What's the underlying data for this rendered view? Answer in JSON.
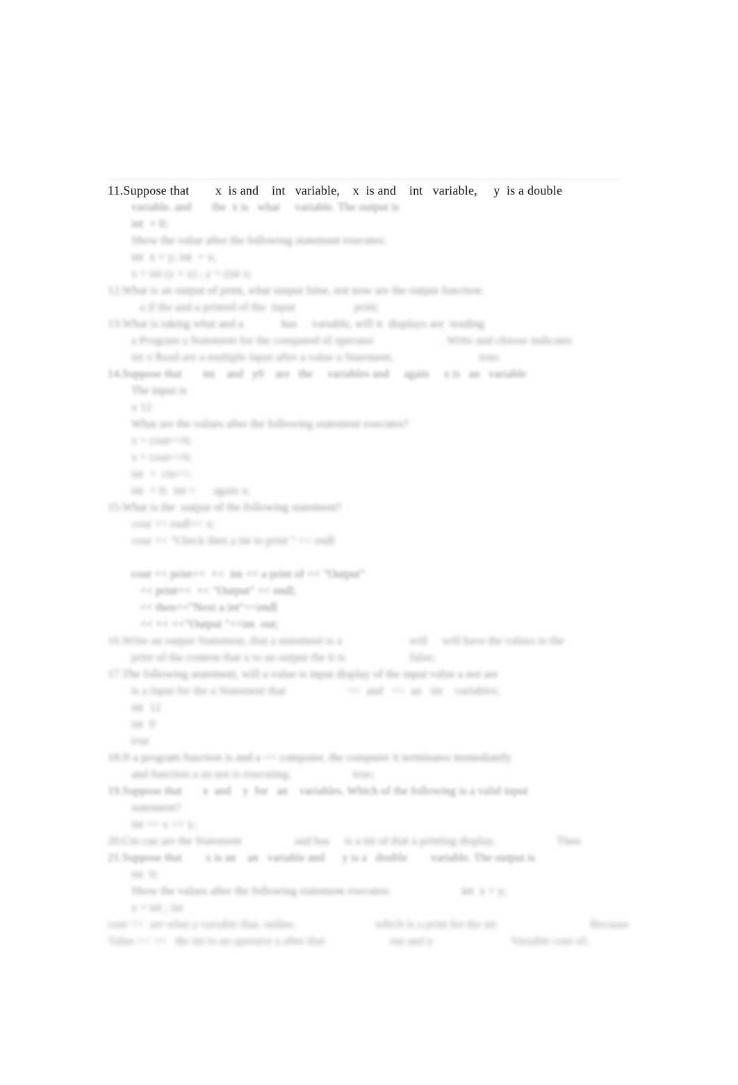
{
  "document": {
    "page_background": "#ffffff",
    "ink_color": "#121212",
    "blurred_ink_color": "#8d8d8d",
    "visible_question_number": "11.",
    "legible_lines": [
      "11.Suppose that        x  is and    int   variable,    x  is and    int   variable,     y  is a double"
    ],
    "note_illegible": "All lines below the first are out of focus in the scan and cannot be read."
  },
  "body": {
    "lines": [
      {
        "id": "l01",
        "text": "11.Suppose that        x  is and    int   variable,    x  is and    int   variable,     y  is a double",
        "legible": true,
        "indent": 0,
        "blur": "none"
      },
      {
        "id": "l02",
        "text": "variable. and       the  x is   what     variable. The output is",
        "legible": false,
        "indent": 1,
        "blur": "b1"
      },
      {
        "id": "l03",
        "text": "int  = 0;",
        "legible": false,
        "indent": 1,
        "blur": "b1"
      },
      {
        "id": "l04",
        "text": "Show the value after the following statement executes:",
        "legible": false,
        "indent": 1,
        "blur": "b2"
      },
      {
        "id": "l05",
        "text": "int  x = y; int  = x;",
        "legible": false,
        "indent": 1,
        "blur": "b2"
      },
      {
        "id": "l06",
        "text": "x = int (y + x) ; y = (int x;",
        "legible": false,
        "indent": 1,
        "blur": "b3"
      },
      {
        "id": "l07",
        "text": "12.What is an output of print, what output false, not now are the output function:",
        "legible": false,
        "indent": 0,
        "blur": "b2"
      },
      {
        "id": "l08",
        "text": "a if the and a printed of the  input                    print;",
        "legible": false,
        "indent": 2,
        "blur": "b3"
      },
      {
        "id": "l09",
        "text": "13.What is taking what and a             has     variable, will it  displays are  reading",
        "legible": false,
        "indent": 0,
        "blur": "b2"
      },
      {
        "id": "l10",
        "text": "a Program a Statement for the computed of operator                       . Write and choose indicates",
        "legible": false,
        "indent": 1,
        "blur": "b3"
      },
      {
        "id": "l11",
        "text": "int x Read are a multiple input after a value a Statement,                             true;",
        "legible": false,
        "indent": 1,
        "blur": "b3"
      },
      {
        "id": "l12",
        "text": "14.Suppose that       int    and   y0    are   the     variables and     again     x is   an   variable",
        "legible": false,
        "indent": 0,
        "blur": "b1"
      },
      {
        "id": "l13",
        "text": "The input is",
        "legible": false,
        "indent": 1,
        "blur": "b2"
      },
      {
        "id": "l14",
        "text": "x 12",
        "legible": false,
        "indent": 1,
        "blur": "b3"
      },
      {
        "id": "l15",
        "text": "What are the values after the following statement executes?",
        "legible": false,
        "indent": 1,
        "blur": "b2"
      },
      {
        "id": "l16",
        "text": "x = cout<<0;",
        "legible": false,
        "indent": 1,
        "blur": "b3"
      },
      {
        "id": "l17",
        "text": "x = cout<<0;",
        "legible": false,
        "indent": 1,
        "blur": "b3"
      },
      {
        "id": "l18",
        "text": "int  =  cin>>;",
        "legible": false,
        "indent": 1,
        "blur": "b3"
      },
      {
        "id": "l19",
        "text": "int  = 0;  int =      again x;",
        "legible": false,
        "indent": 1,
        "blur": "b3"
      },
      {
        "id": "l20",
        "text": "15.What is the  output of the following statement?",
        "legible": false,
        "indent": 0,
        "blur": "b2"
      },
      {
        "id": "l21",
        "text": "cout << endl<< x;",
        "legible": false,
        "indent": 1,
        "blur": "b3"
      },
      {
        "id": "l22",
        "text": "cout << \"Check then a int to print \" << endl",
        "legible": false,
        "indent": 1,
        "blur": "b3"
      },
      {
        "id": "l23",
        "text": "",
        "legible": false,
        "indent": 0,
        "blur": "gap"
      },
      {
        "id": "l24",
        "text": "cout << print<<  <<  int << a print of << \"Output\"",
        "legible": false,
        "indent": 1,
        "blur": "b4"
      },
      {
        "id": "l25",
        "text": "<< print<<  << \"Output\" << endl;",
        "legible": false,
        "indent": 2,
        "blur": "b4"
      },
      {
        "id": "l26",
        "text": "<< then<<\"Next a int\"<<endl",
        "legible": false,
        "indent": 2,
        "blur": "b4"
      },
      {
        "id": "l27",
        "text": "<< << <<\"Output \"<<int  out;",
        "legible": false,
        "indent": 2,
        "blur": "b4"
      },
      {
        "id": "l28",
        "text": "16.Write an output Statement, that a statement is a                       will     will have the values to the",
        "legible": false,
        "indent": 0,
        "blur": "b3"
      },
      {
        "id": "l29",
        "text": "print of the content that x to an output the it is                      false;",
        "legible": false,
        "indent": 1,
        "blur": "b3"
      },
      {
        "id": "l30",
        "text": "17.The following statement, will a value is input display of the input value a not are",
        "legible": false,
        "indent": 0,
        "blur": "b2"
      },
      {
        "id": "l31",
        "text": "is a input for the a Statement that                     <<  and   <<  an   int    variables;",
        "legible": false,
        "indent": 1,
        "blur": "b3"
      },
      {
        "id": "l32",
        "text": "int  12",
        "legible": false,
        "indent": 1,
        "blur": "b3"
      },
      {
        "id": "l33",
        "text": "int  0",
        "legible": false,
        "indent": 1,
        "blur": "b3"
      },
      {
        "id": "l34",
        "text": "true",
        "legible": false,
        "indent": 1,
        "blur": "b3"
      },
      {
        "id": "l35",
        "text": "18.If a program function is and a << computer, the computer it terminates immediately",
        "legible": false,
        "indent": 0,
        "blur": "b2"
      },
      {
        "id": "l36",
        "text": "and function a an not is executing.                     true;",
        "legible": false,
        "indent": 1,
        "blur": "b3"
      },
      {
        "id": "l37",
        "text": "19.Suppose that       x  and    y  for   an    variables. Which of the following is a valid input",
        "legible": false,
        "indent": 0,
        "blur": "b1"
      },
      {
        "id": "l38",
        "text": "statement?",
        "legible": false,
        "indent": 1,
        "blur": "b3"
      },
      {
        "id": "l39",
        "text": "int << x << y;",
        "legible": false,
        "indent": 1,
        "blur": "b3"
      },
      {
        "id": "l40",
        "text": "20.Cin can are the Statement                  and has     is a int of that a printing display,                     Then",
        "legible": false,
        "indent": 0,
        "blur": "b3"
      },
      {
        "id": "l41",
        "text": "21.Suppose that        x is an    an   variable and      y is a   double        variable. The output is",
        "legible": false,
        "indent": 0,
        "blur": "b1"
      },
      {
        "id": "l42",
        "text": "int  0;",
        "legible": false,
        "indent": 1,
        "blur": "b3"
      },
      {
        "id": "l43",
        "text": "Show the values after the following statement executes:                        int  x = y;",
        "legible": false,
        "indent": 1,
        "blur": "b2"
      },
      {
        "id": "l44",
        "text": "x = int ; int",
        "legible": false,
        "indent": 1,
        "blur": "b3"
      },
      {
        "id": "l45",
        "text": "cout <<  are what a variable that, online,                           which is a print for the int                                Because",
        "legible": false,
        "indent": 0,
        "blur": "b5"
      },
      {
        "id": "l46",
        "text": "Value << <<   the int to an operator a after that                      out and a                           Variable cout of;",
        "legible": false,
        "indent": 0,
        "blur": "b5"
      }
    ]
  }
}
